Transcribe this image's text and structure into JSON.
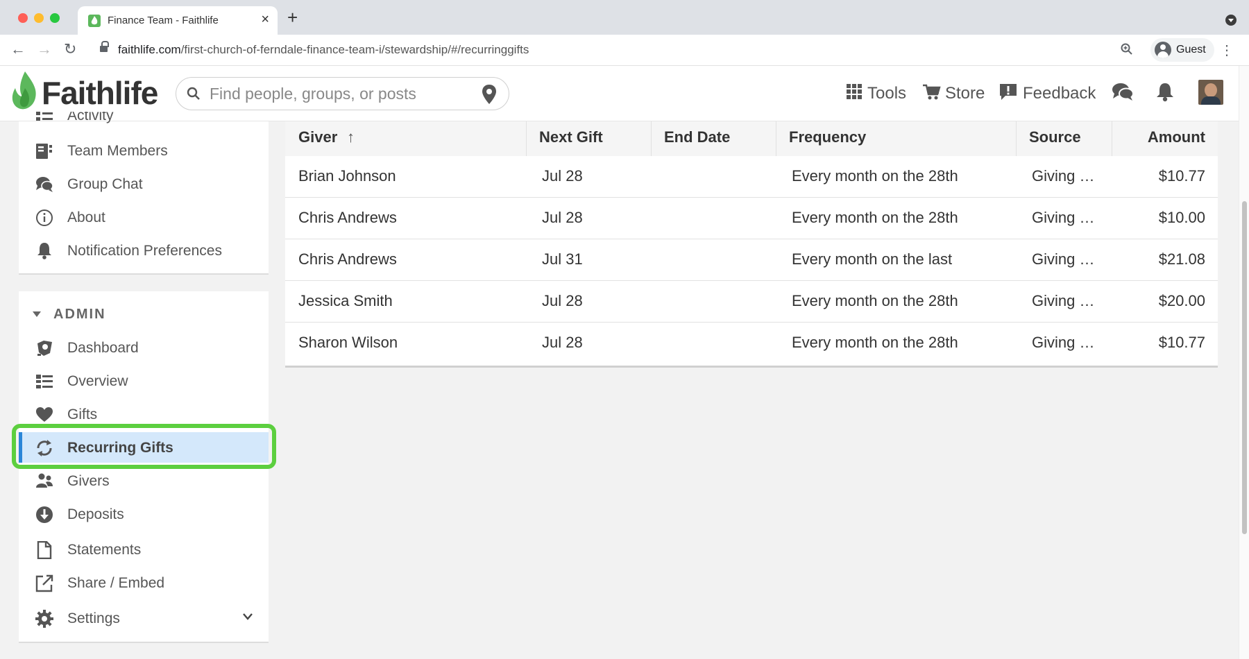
{
  "browser": {
    "tab_title": "Finance Team - Faithlife",
    "tab_close": "×",
    "new_tab": "+",
    "url_host": "faithlife.com",
    "url_path": "/first-church-of-ferndale-finance-team-i/stewardship/#/recurringgifts",
    "profile_label": "Guest"
  },
  "header": {
    "logo_text": "Faithlife",
    "search_placeholder": "Find people, groups, or posts",
    "tools_label": "Tools",
    "store_label": "Store",
    "feedback_label": "Feedback"
  },
  "sidebar": {
    "top_items": [
      {
        "label": "Activity",
        "icon": "activity-icon"
      },
      {
        "label": "Team Members",
        "icon": "team-members-icon"
      },
      {
        "label": "Group Chat",
        "icon": "group-chat-icon"
      },
      {
        "label": "About",
        "icon": "info-icon"
      },
      {
        "label": "Notification Preferences",
        "icon": "bell-icon"
      }
    ],
    "admin_heading": "ADMIN",
    "admin_items": [
      {
        "label": "Dashboard",
        "icon": "dashboard-icon"
      },
      {
        "label": "Overview",
        "icon": "overview-icon"
      },
      {
        "label": "Gifts",
        "icon": "heart-icon"
      },
      {
        "label": "Recurring Gifts",
        "icon": "recurring-icon",
        "active": true
      },
      {
        "label": "Givers",
        "icon": "givers-icon"
      },
      {
        "label": "Deposits",
        "icon": "deposit-icon"
      },
      {
        "label": "Statements",
        "icon": "statement-icon"
      },
      {
        "label": "Share / Embed",
        "icon": "share-icon"
      },
      {
        "label": "Settings",
        "icon": "gear-icon"
      }
    ]
  },
  "table": {
    "columns": [
      "Giver",
      "Next Gift",
      "End Date",
      "Frequency",
      "Source",
      "Amount"
    ],
    "sort_indicator": "↑",
    "rows": [
      {
        "giver": "Brian Johnson",
        "next_gift": "Jul 28",
        "end_date": "",
        "frequency": "Every month on the 28th",
        "source": "Giving …",
        "amount": "$10.77"
      },
      {
        "giver": "Chris Andrews",
        "next_gift": "Jul 28",
        "end_date": "",
        "frequency": "Every month on the 28th",
        "source": "Giving …",
        "amount": "$10.00"
      },
      {
        "giver": "Chris Andrews",
        "next_gift": "Jul 31",
        "end_date": "",
        "frequency": "Every month on the last",
        "source": "Giving …",
        "amount": "$21.08"
      },
      {
        "giver": "Jessica Smith",
        "next_gift": "Jul 28",
        "end_date": "",
        "frequency": "Every month on the 28th",
        "source": "Giving …",
        "amount": "$20.00"
      },
      {
        "giver": "Sharon Wilson",
        "next_gift": "Jul 28",
        "end_date": "",
        "frequency": "Every month on the 28th",
        "source": "Giving …",
        "amount": "$10.77"
      }
    ]
  },
  "colors": {
    "brand_green": "#5cb85c",
    "active_bg": "#d4e8fb",
    "active_bar": "#2b86d8",
    "highlight_ring": "#5ccf3f"
  }
}
